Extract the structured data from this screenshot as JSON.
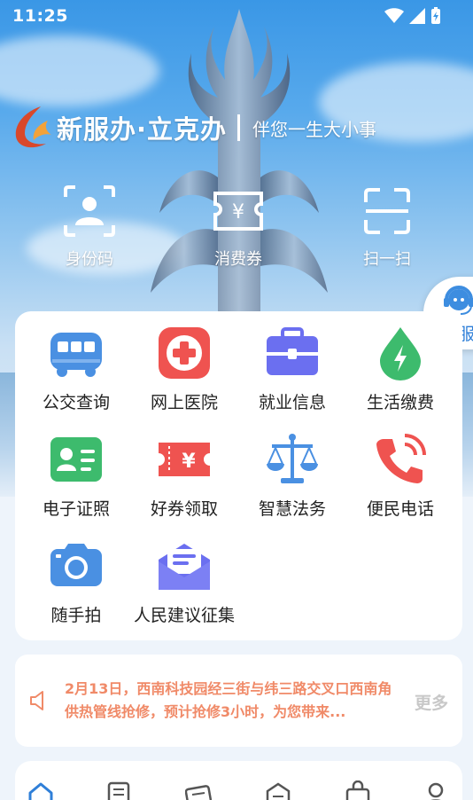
{
  "status_bar": {
    "time": "11:25"
  },
  "brand": {
    "name": "新服办·立克办",
    "slogan": "伴您一生大小事"
  },
  "quick_actions": [
    {
      "label": "身份码",
      "icon": "id-code-icon"
    },
    {
      "label": "消费券",
      "icon": "voucher-icon"
    },
    {
      "label": "扫一扫",
      "icon": "scan-icon"
    }
  ],
  "customer_service": {
    "label": "客服"
  },
  "services": [
    {
      "label": "公交查询",
      "icon": "bus-icon",
      "color": "#4a90e2"
    },
    {
      "label": "网上医院",
      "icon": "hospital-icon",
      "color": "#ef5350"
    },
    {
      "label": "就业信息",
      "icon": "briefcase-icon",
      "color": "#6b6ff0"
    },
    {
      "label": "生活缴费",
      "icon": "utility-drop-icon",
      "color": "#3dbb6d"
    },
    {
      "label": "电子证照",
      "icon": "id-card-icon",
      "color": "#3dbb6d"
    },
    {
      "label": "好券领取",
      "icon": "coupon-icon",
      "color": "#ef5350"
    },
    {
      "label": "智慧法务",
      "icon": "scales-icon",
      "color": "#4a90e2"
    },
    {
      "label": "便民电话",
      "icon": "phone-icon",
      "color": "#ef5350"
    },
    {
      "label": "随手拍",
      "icon": "camera-icon",
      "color": "#4a90e2"
    },
    {
      "label": "人民建议征集",
      "icon": "mail-icon",
      "color": "#6b6ff0"
    }
  ],
  "notice": {
    "text": "2月13日，西南科技园经三街与纬三路交叉口西南角供热管线抢修，预计抢修3小时，为您带来...",
    "more_label": "更多",
    "accent": "#f08a68"
  },
  "bottom_nav": [
    {
      "icon": "home-icon",
      "active": true
    },
    {
      "icon": "list-icon"
    },
    {
      "icon": "news-icon"
    },
    {
      "icon": "building-icon"
    },
    {
      "icon": "bag-icon"
    },
    {
      "icon": "profile-icon"
    }
  ]
}
